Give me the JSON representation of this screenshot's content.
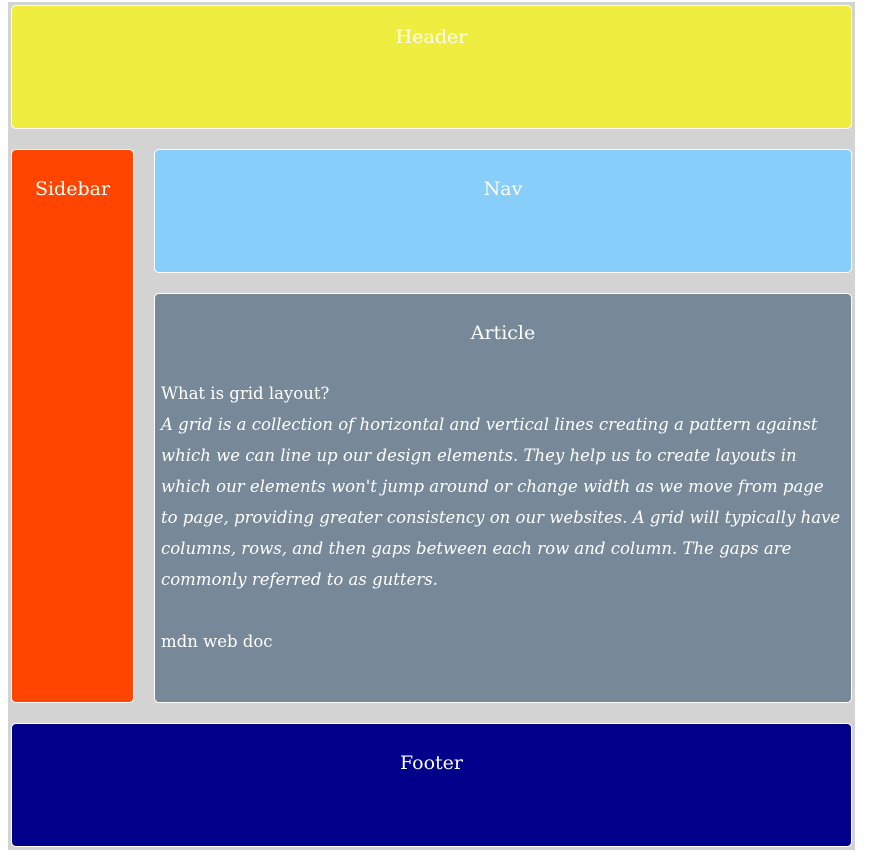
{
  "header": {
    "label": "Header"
  },
  "sidebar": {
    "label": "Sidebar"
  },
  "nav": {
    "label": "Nav"
  },
  "article": {
    "label": "Article",
    "question": "What is grid layout?",
    "paragraph": "A grid is a collection of horizontal and vertical lines creating a pattern against which we can line up our design elements. They help us to create layouts in which our elements won't jump around or change width as we move from page to page, providing greater consistency on our websites. A grid will typically have columns, rows, and then gaps between each row and column. The gaps are commonly referred to as gutters.",
    "source": "mdn web doc"
  },
  "footer": {
    "label": "Footer"
  },
  "colors": {
    "background": "#d3d3d3",
    "header": "#efed3f",
    "sidebar": "#ff4500",
    "nav": "#87cefa",
    "article": "#778899",
    "footer": "#00008b",
    "text": "#ffffff"
  }
}
